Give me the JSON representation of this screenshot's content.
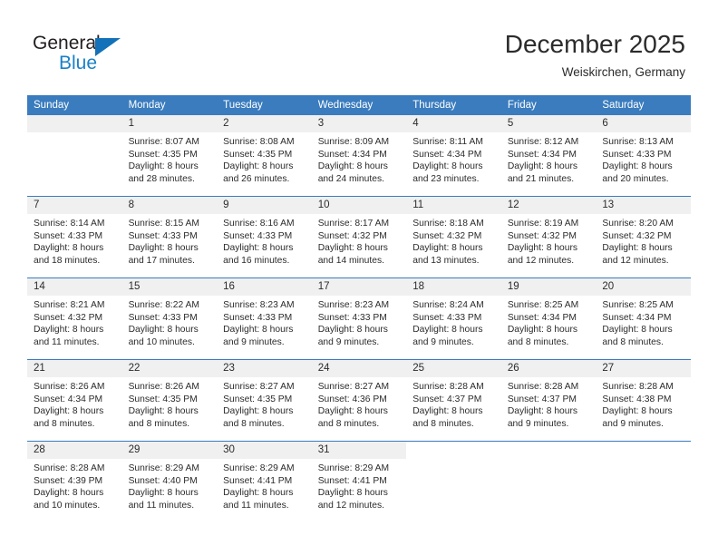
{
  "brand": {
    "name_part1": "General",
    "name_part2": "Blue",
    "triangle_color": "#1271b8",
    "blue_color": "#1a81c7"
  },
  "header": {
    "title": "December 2025",
    "location": "Weiskirchen, Germany"
  },
  "theme": {
    "header_bg": "#3a7cbe",
    "daynum_bg": "#f0f0f0",
    "text_color": "#2b2b2b"
  },
  "weekdays": [
    "Sunday",
    "Monday",
    "Tuesday",
    "Wednesday",
    "Thursday",
    "Friday",
    "Saturday"
  ],
  "labels": {
    "sunrise": "Sunrise:",
    "sunset": "Sunset:",
    "daylight": "Daylight:"
  },
  "weeks": [
    [
      {
        "day": "",
        "lines": []
      },
      {
        "day": "1",
        "lines": [
          "Sunrise: 8:07 AM",
          "Sunset: 4:35 PM",
          "Daylight: 8 hours",
          "and 28 minutes."
        ]
      },
      {
        "day": "2",
        "lines": [
          "Sunrise: 8:08 AM",
          "Sunset: 4:35 PM",
          "Daylight: 8 hours",
          "and 26 minutes."
        ]
      },
      {
        "day": "3",
        "lines": [
          "Sunrise: 8:09 AM",
          "Sunset: 4:34 PM",
          "Daylight: 8 hours",
          "and 24 minutes."
        ]
      },
      {
        "day": "4",
        "lines": [
          "Sunrise: 8:11 AM",
          "Sunset: 4:34 PM",
          "Daylight: 8 hours",
          "and 23 minutes."
        ]
      },
      {
        "day": "5",
        "lines": [
          "Sunrise: 8:12 AM",
          "Sunset: 4:34 PM",
          "Daylight: 8 hours",
          "and 21 minutes."
        ]
      },
      {
        "day": "6",
        "lines": [
          "Sunrise: 8:13 AM",
          "Sunset: 4:33 PM",
          "Daylight: 8 hours",
          "and 20 minutes."
        ]
      }
    ],
    [
      {
        "day": "7",
        "lines": [
          "Sunrise: 8:14 AM",
          "Sunset: 4:33 PM",
          "Daylight: 8 hours",
          "and 18 minutes."
        ]
      },
      {
        "day": "8",
        "lines": [
          "Sunrise: 8:15 AM",
          "Sunset: 4:33 PM",
          "Daylight: 8 hours",
          "and 17 minutes."
        ]
      },
      {
        "day": "9",
        "lines": [
          "Sunrise: 8:16 AM",
          "Sunset: 4:33 PM",
          "Daylight: 8 hours",
          "and 16 minutes."
        ]
      },
      {
        "day": "10",
        "lines": [
          "Sunrise: 8:17 AM",
          "Sunset: 4:32 PM",
          "Daylight: 8 hours",
          "and 14 minutes."
        ]
      },
      {
        "day": "11",
        "lines": [
          "Sunrise: 8:18 AM",
          "Sunset: 4:32 PM",
          "Daylight: 8 hours",
          "and 13 minutes."
        ]
      },
      {
        "day": "12",
        "lines": [
          "Sunrise: 8:19 AM",
          "Sunset: 4:32 PM",
          "Daylight: 8 hours",
          "and 12 minutes."
        ]
      },
      {
        "day": "13",
        "lines": [
          "Sunrise: 8:20 AM",
          "Sunset: 4:32 PM",
          "Daylight: 8 hours",
          "and 12 minutes."
        ]
      }
    ],
    [
      {
        "day": "14",
        "lines": [
          "Sunrise: 8:21 AM",
          "Sunset: 4:32 PM",
          "Daylight: 8 hours",
          "and 11 minutes."
        ]
      },
      {
        "day": "15",
        "lines": [
          "Sunrise: 8:22 AM",
          "Sunset: 4:33 PM",
          "Daylight: 8 hours",
          "and 10 minutes."
        ]
      },
      {
        "day": "16",
        "lines": [
          "Sunrise: 8:23 AM",
          "Sunset: 4:33 PM",
          "Daylight: 8 hours",
          "and 9 minutes."
        ]
      },
      {
        "day": "17",
        "lines": [
          "Sunrise: 8:23 AM",
          "Sunset: 4:33 PM",
          "Daylight: 8 hours",
          "and 9 minutes."
        ]
      },
      {
        "day": "18",
        "lines": [
          "Sunrise: 8:24 AM",
          "Sunset: 4:33 PM",
          "Daylight: 8 hours",
          "and 9 minutes."
        ]
      },
      {
        "day": "19",
        "lines": [
          "Sunrise: 8:25 AM",
          "Sunset: 4:34 PM",
          "Daylight: 8 hours",
          "and 8 minutes."
        ]
      },
      {
        "day": "20",
        "lines": [
          "Sunrise: 8:25 AM",
          "Sunset: 4:34 PM",
          "Daylight: 8 hours",
          "and 8 minutes."
        ]
      }
    ],
    [
      {
        "day": "21",
        "lines": [
          "Sunrise: 8:26 AM",
          "Sunset: 4:34 PM",
          "Daylight: 8 hours",
          "and 8 minutes."
        ]
      },
      {
        "day": "22",
        "lines": [
          "Sunrise: 8:26 AM",
          "Sunset: 4:35 PM",
          "Daylight: 8 hours",
          "and 8 minutes."
        ]
      },
      {
        "day": "23",
        "lines": [
          "Sunrise: 8:27 AM",
          "Sunset: 4:35 PM",
          "Daylight: 8 hours",
          "and 8 minutes."
        ]
      },
      {
        "day": "24",
        "lines": [
          "Sunrise: 8:27 AM",
          "Sunset: 4:36 PM",
          "Daylight: 8 hours",
          "and 8 minutes."
        ]
      },
      {
        "day": "25",
        "lines": [
          "Sunrise: 8:28 AM",
          "Sunset: 4:37 PM",
          "Daylight: 8 hours",
          "and 8 minutes."
        ]
      },
      {
        "day": "26",
        "lines": [
          "Sunrise: 8:28 AM",
          "Sunset: 4:37 PM",
          "Daylight: 8 hours",
          "and 9 minutes."
        ]
      },
      {
        "day": "27",
        "lines": [
          "Sunrise: 8:28 AM",
          "Sunset: 4:38 PM",
          "Daylight: 8 hours",
          "and 9 minutes."
        ]
      }
    ],
    [
      {
        "day": "28",
        "lines": [
          "Sunrise: 8:28 AM",
          "Sunset: 4:39 PM",
          "Daylight: 8 hours",
          "and 10 minutes."
        ]
      },
      {
        "day": "29",
        "lines": [
          "Sunrise: 8:29 AM",
          "Sunset: 4:40 PM",
          "Daylight: 8 hours",
          "and 11 minutes."
        ]
      },
      {
        "day": "30",
        "lines": [
          "Sunrise: 8:29 AM",
          "Sunset: 4:41 PM",
          "Daylight: 8 hours",
          "and 11 minutes."
        ]
      },
      {
        "day": "31",
        "lines": [
          "Sunrise: 8:29 AM",
          "Sunset: 4:41 PM",
          "Daylight: 8 hours",
          "and 12 minutes."
        ]
      },
      {
        "day": "",
        "lines": []
      },
      {
        "day": "",
        "lines": []
      },
      {
        "day": "",
        "lines": []
      }
    ]
  ]
}
